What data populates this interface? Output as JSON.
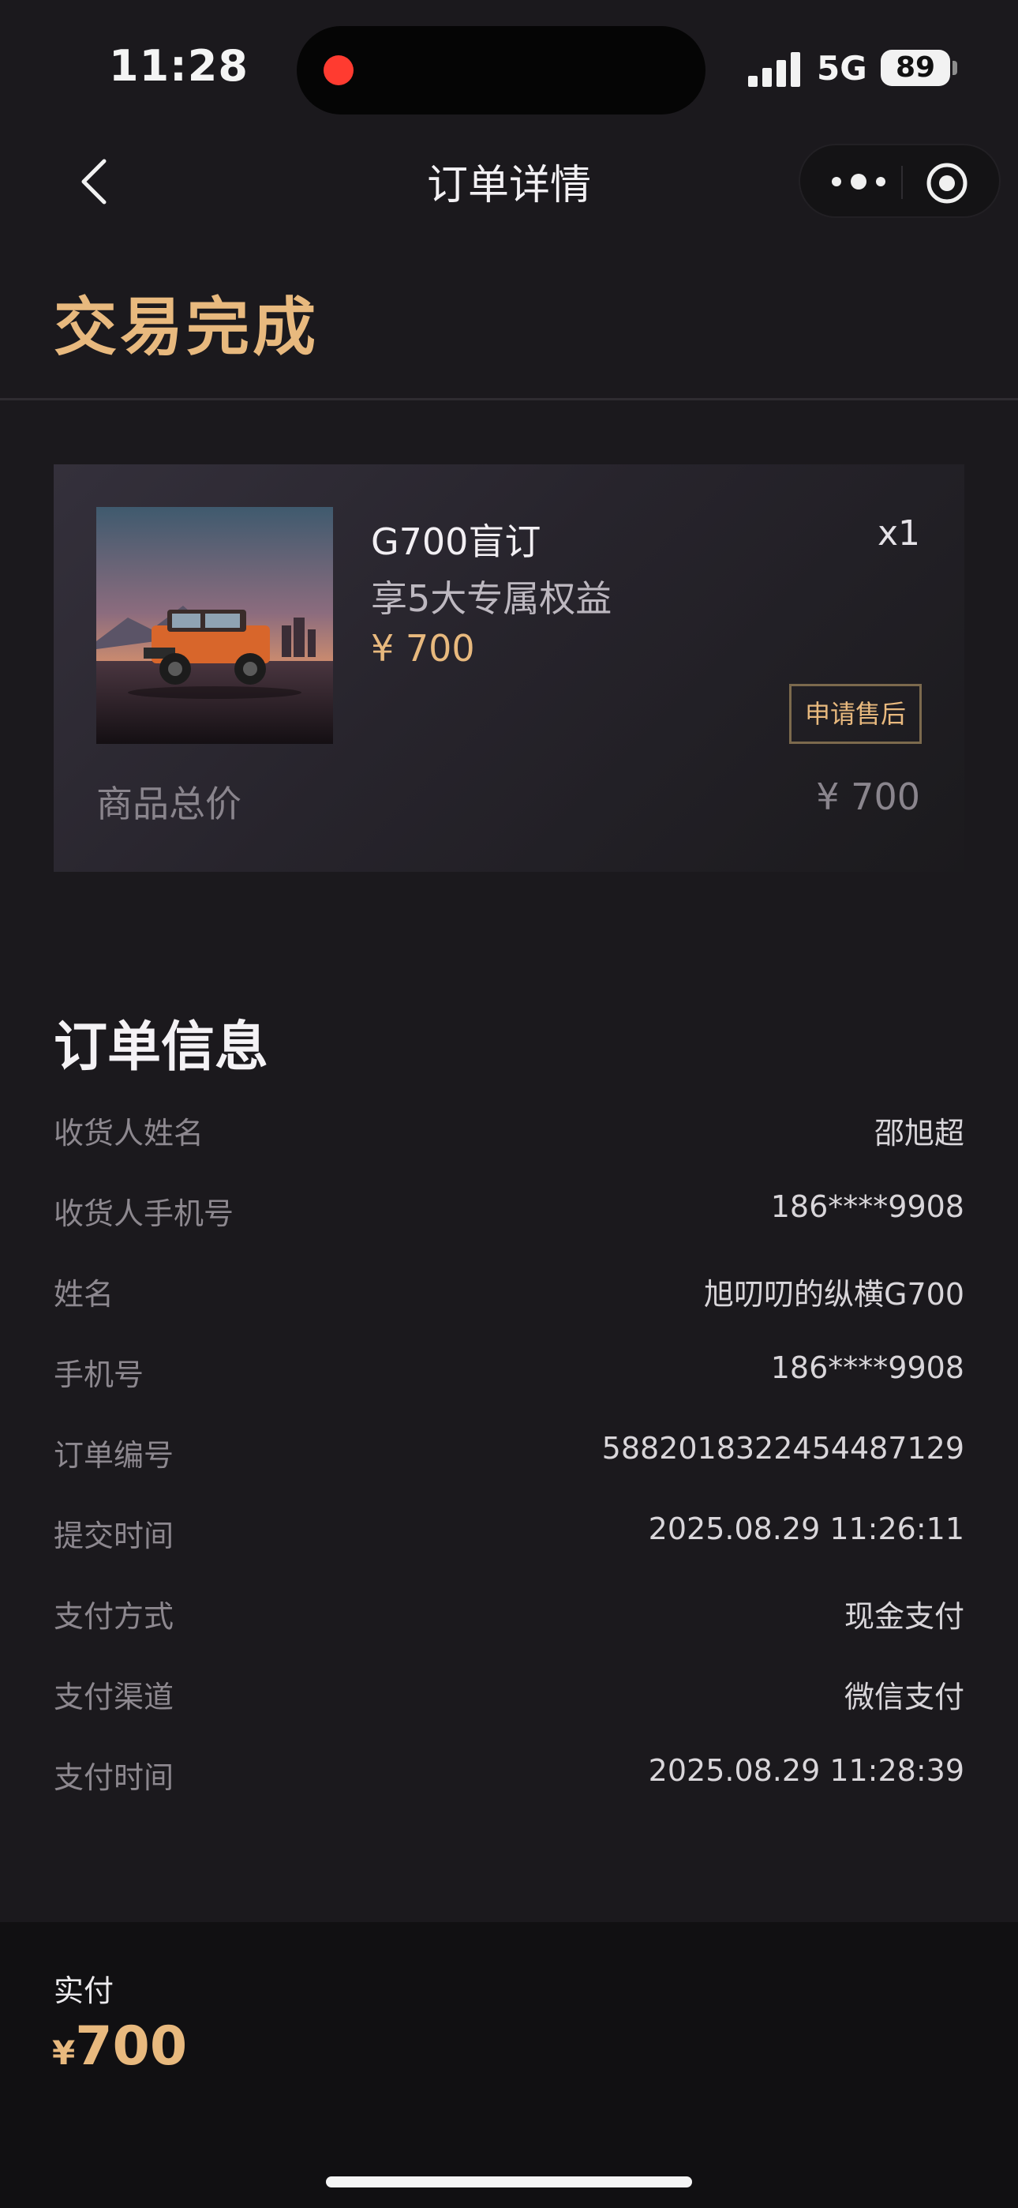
{
  "status_bar": {
    "time": "11:28",
    "network": "5G",
    "battery": "89"
  },
  "nav": {
    "title": "订单详情"
  },
  "order_status": "交易完成",
  "product": {
    "name": "G700盲订",
    "quantity": "x1",
    "description": "享5大专属权益",
    "price": "¥ 700",
    "after_sale_button": "申请售后",
    "total_label": "商品总价",
    "total_value": "¥ 700"
  },
  "order_info": {
    "title": "订单信息",
    "rows": [
      {
        "label": "收货人姓名",
        "value": "邵旭超"
      },
      {
        "label": "收货人手机号",
        "value": "186****9908"
      },
      {
        "label": "姓名",
        "value": "旭叨叨的纵横G700"
      },
      {
        "label": "手机号",
        "value": "186****9908"
      },
      {
        "label": "订单编号",
        "value": "5882018322454487129"
      },
      {
        "label": "提交时间",
        "value": "2025.08.29 11:26:11"
      },
      {
        "label": "支付方式",
        "value": "现金支付"
      },
      {
        "label": "支付渠道",
        "value": "微信支付"
      },
      {
        "label": "支付时间",
        "value": "2025.08.29 11:28:39"
      }
    ]
  },
  "footer": {
    "paid_label": "实付",
    "currency": "¥",
    "amount": "700"
  },
  "colors": {
    "accent_gold": "#e8b97e",
    "background": "#1b191d",
    "recording_dot": "#ff3b30"
  },
  "icons": [
    "back-icon",
    "more-icon",
    "close-target-icon",
    "signal-icon",
    "battery-icon"
  ]
}
